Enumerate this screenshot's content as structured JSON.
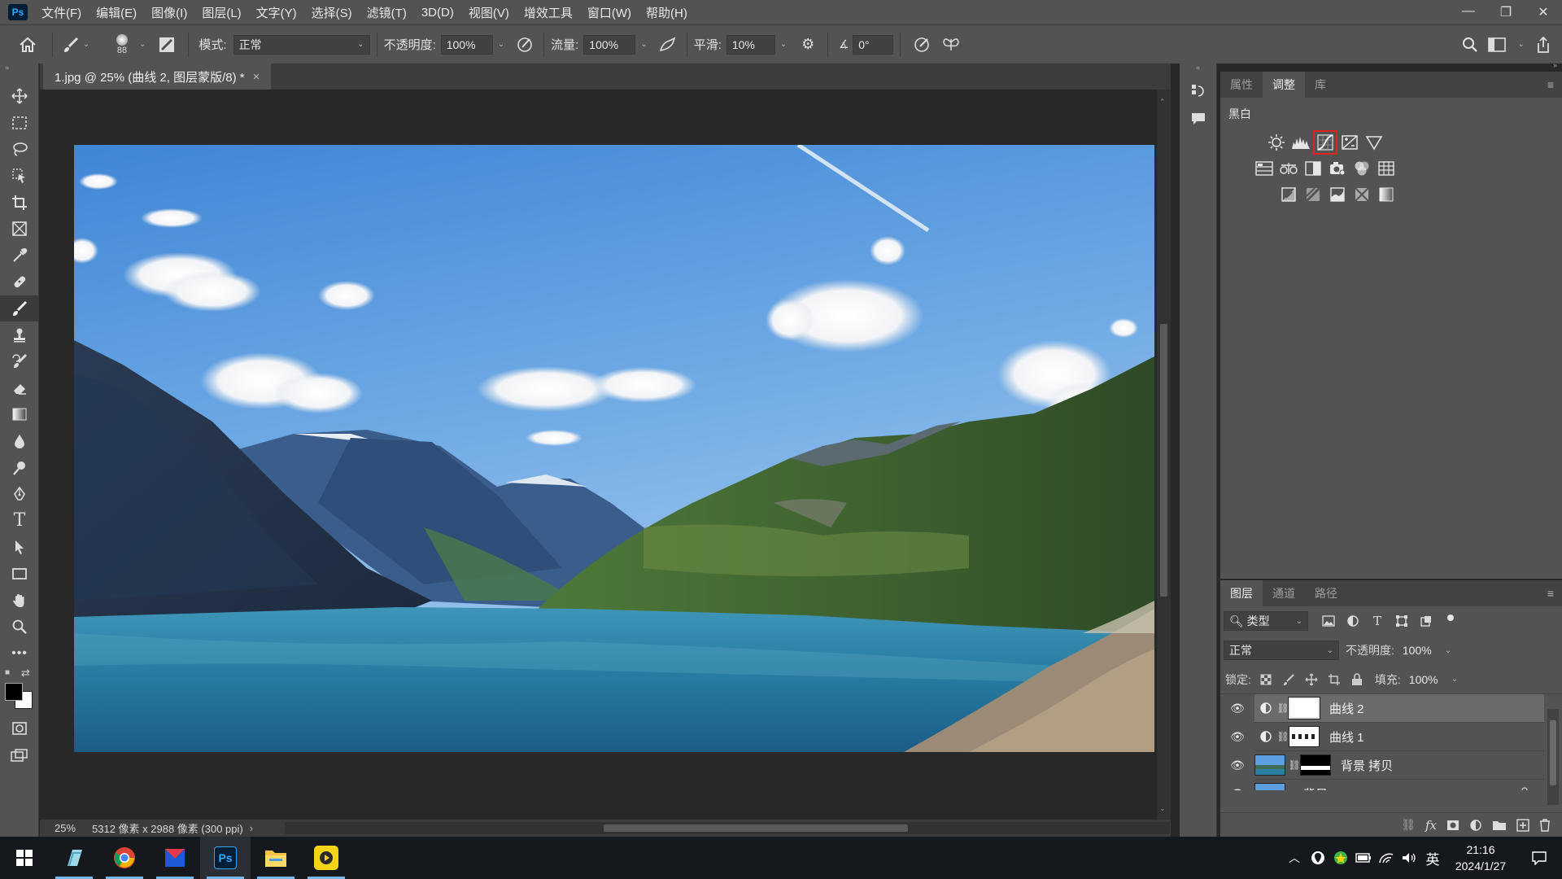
{
  "app": {
    "logo": "Ps"
  },
  "menubar": {
    "items": [
      "文件(F)",
      "编辑(E)",
      "图像(I)",
      "图层(L)",
      "文字(Y)",
      "选择(S)",
      "滤镜(T)",
      "3D(D)",
      "视图(V)",
      "增效工具",
      "窗口(W)",
      "帮助(H)"
    ],
    "window_controls": [
      "—",
      "❐",
      "✕"
    ]
  },
  "options": {
    "brush_size": "88",
    "mode_label": "模式:",
    "mode_value": "正常",
    "opacity_label": "不透明度:",
    "opacity_value": "100%",
    "flow_label": "流量:",
    "flow_value": "100%",
    "smooth_label": "平滑:",
    "smooth_value": "10%",
    "angle_value": "0°"
  },
  "document": {
    "tab_title": "1.jpg @ 25% (曲线 2, 图层蒙版/8) *",
    "tab_close": "×",
    "zoom": "25%",
    "doc_info": "5312 像素 x 2988 像素 (300 ppi)",
    "status_arrow": "›"
  },
  "adjustments": {
    "tabs": [
      "属性",
      "调整",
      "库"
    ],
    "active_tab": 1,
    "current_hint": "黑白",
    "highlight_color": "#e0231b"
  },
  "layers": {
    "tabs": [
      "图层",
      "通道",
      "路径"
    ],
    "filter_label": "类型",
    "blend_mode": "正常",
    "opacity_label": "不透明度:",
    "opacity_value": "100%",
    "lock_label": "锁定:",
    "fill_label": "填充:",
    "fill_value": "100%",
    "rows": [
      {
        "name": "曲线 2",
        "selected": true
      },
      {
        "name": "曲线 1",
        "selected": false
      },
      {
        "name": "背景 拷贝",
        "selected": false
      },
      {
        "name": "背景",
        "selected": false
      }
    ]
  },
  "taskbar": {
    "time": "21:16",
    "date": "2024/1/27",
    "ime": "英"
  }
}
